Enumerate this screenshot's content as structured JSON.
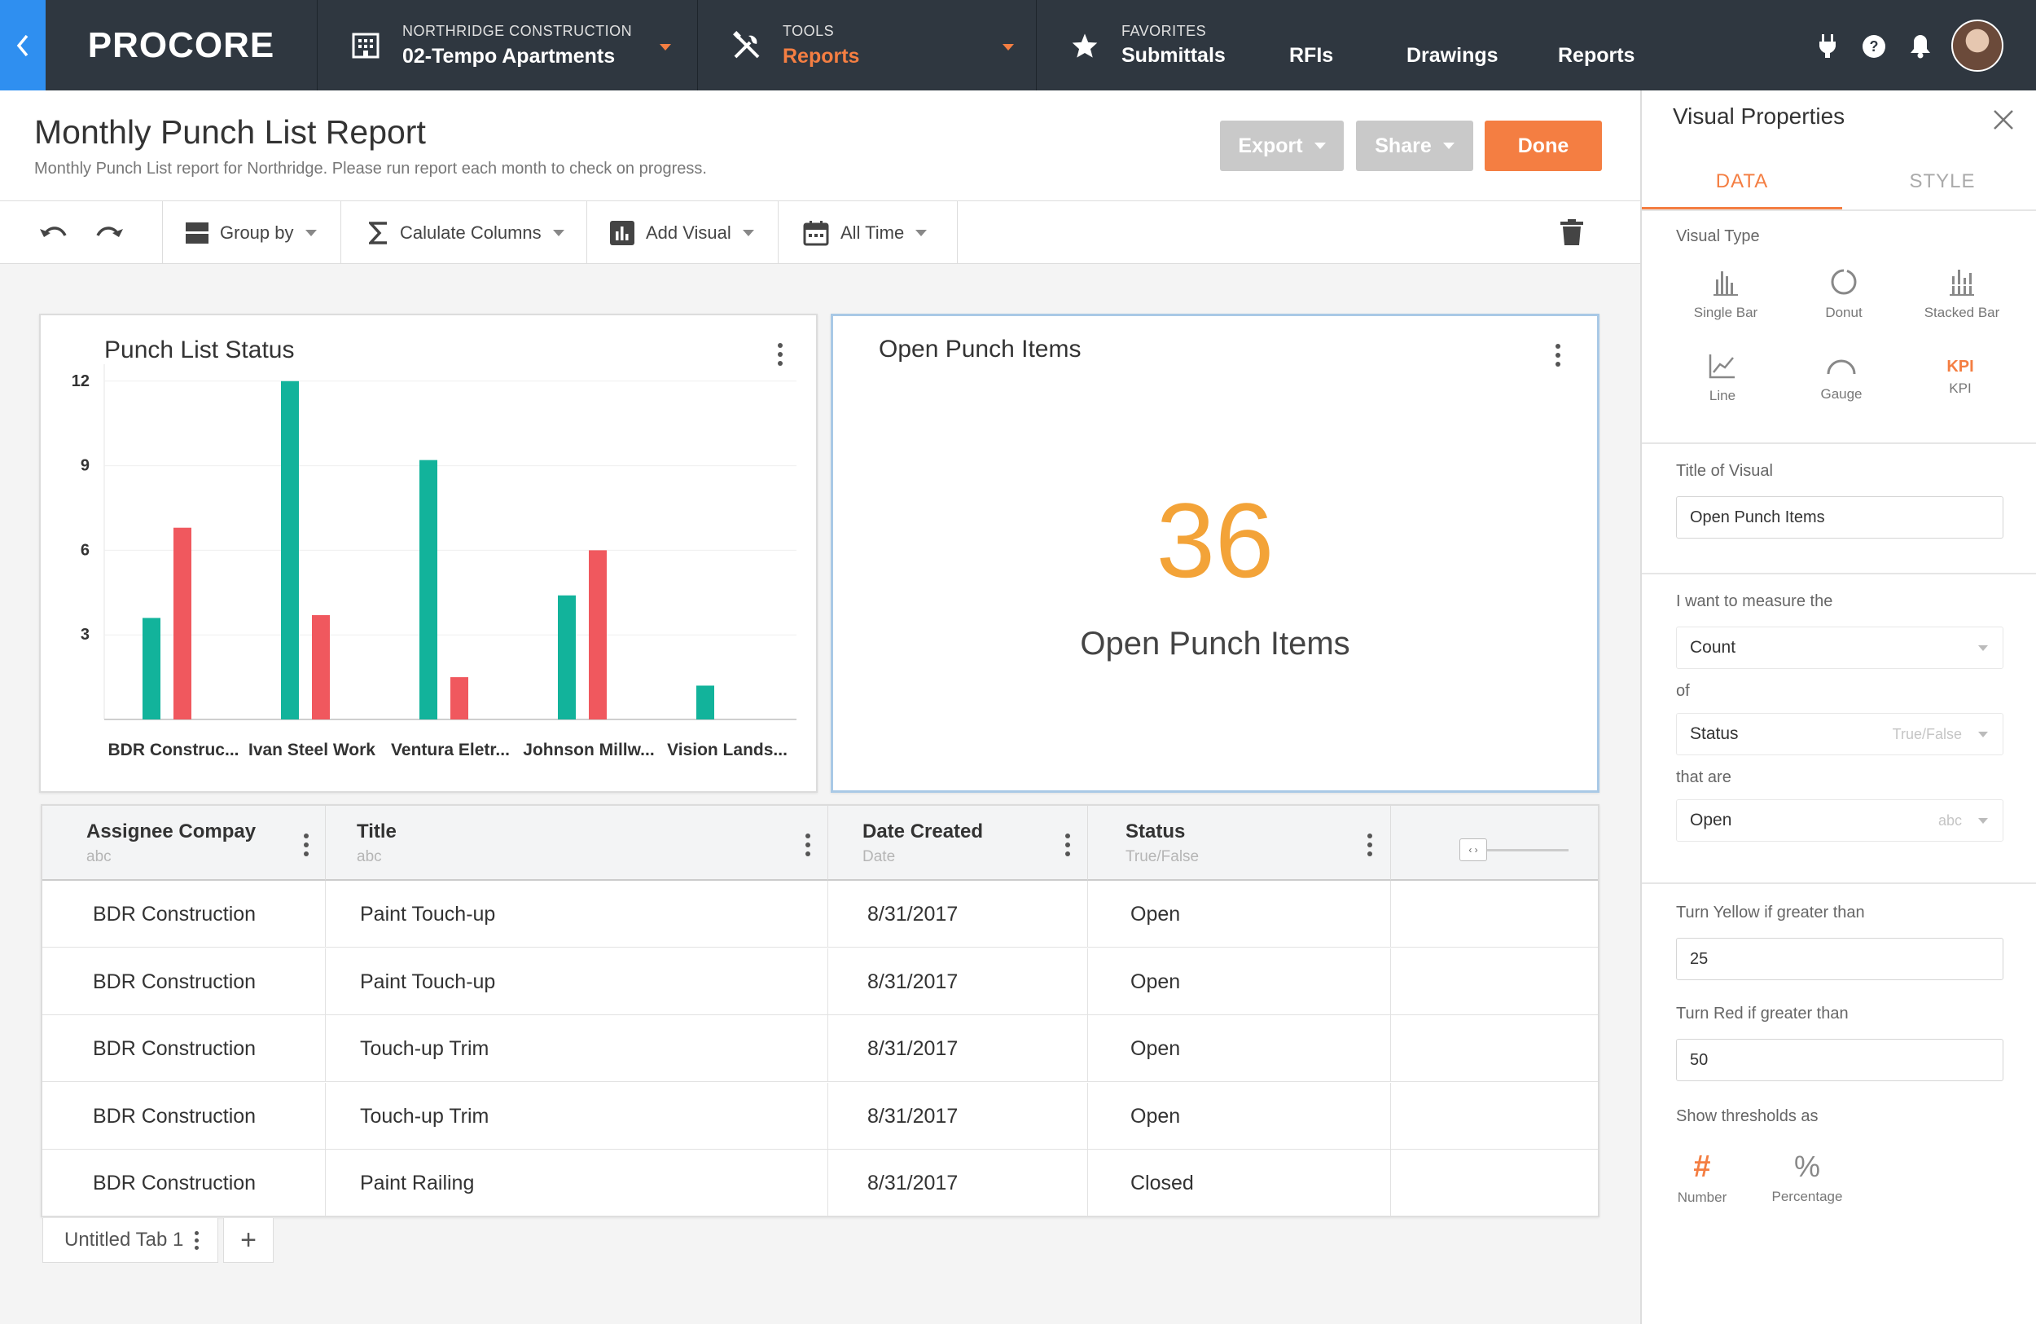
{
  "nav": {
    "logo": "PROCORE",
    "project_company": "NORTHRIDGE CONSTRUCTION",
    "project_name": "02-Tempo Apartments",
    "tools_label": "TOOLS",
    "tools_current": "Reports",
    "favorites_label": "FAVORITES",
    "favorites": [
      "Submittals",
      "RFIs",
      "Drawings",
      "Reports"
    ],
    "accent": "#f47e42",
    "back_color": "#2f8ff0"
  },
  "header": {
    "title": "Monthly Punch List Report",
    "subtitle": "Monthly Punch List report for Northridge. Please run report each month to check  on progress.",
    "export_label": "Export",
    "share_label": "Share",
    "done_label": "Done"
  },
  "toolbar": {
    "group_by": "Group by",
    "calculate_columns": "Calulate Columns",
    "add_visual": "Add Visual",
    "time_range": "All Time"
  },
  "chart_card": {
    "title": "Punch List Status"
  },
  "chart_data": {
    "type": "bar",
    "categories": [
      "BDR Construc...",
      "Ivan Steel Work",
      "Ventura Eletr...",
      "Johnson Millw...",
      "Vision Lands..."
    ],
    "series": [
      {
        "values": [
          3.6,
          12,
          9.2,
          4.4,
          1.2
        ],
        "color": "#12b39b"
      },
      {
        "values": [
          6.8,
          3.7,
          1.5,
          6,
          0
        ],
        "color": "#f0585e"
      }
    ],
    "yticks": [
      3,
      6,
      9,
      12
    ],
    "ylim": [
      0,
      12.6
    ],
    "grid": true
  },
  "kpi_card": {
    "title": "Open Punch Items",
    "value": "36",
    "label": "Open Punch Items",
    "value_color": "#f3a338"
  },
  "table": {
    "columns": [
      {
        "header": "Assignee Compay",
        "type": "abc"
      },
      {
        "header": "Title",
        "type": "abc"
      },
      {
        "header": "Date Created",
        "type": "Date"
      },
      {
        "header": "Status",
        "type": "True/False"
      }
    ],
    "rows": [
      [
        "BDR Construction",
        "Paint Touch-up",
        "8/31/2017",
        "Open"
      ],
      [
        "BDR Construction",
        "Paint Touch-up",
        "8/31/2017",
        "Open"
      ],
      [
        "BDR Construction",
        "Touch-up Trim",
        "8/31/2017",
        "Open"
      ],
      [
        "BDR Construction",
        "Touch-up Trim",
        "8/31/2017",
        "Open"
      ],
      [
        "BDR Construction",
        "Paint Railing",
        "8/31/2017",
        "Closed"
      ]
    ]
  },
  "tabs": {
    "items": [
      "Untitled Tab 1"
    ],
    "add": "+"
  },
  "panel": {
    "title": "Visual Properties",
    "tab_data": "DATA",
    "tab_style": "STYLE",
    "visual_type_label": "Visual Type",
    "visual_types": [
      "Single Bar",
      "Donut",
      "Stacked Bar",
      "Line",
      "Gauge",
      "KPI"
    ],
    "kpi_icon_text": "KPI",
    "title_label": "Title of Visual",
    "title_value": "Open Punch Items",
    "measure_label": "I want to measure the",
    "measure_value": "Count",
    "of_label": "of",
    "of_value": "Status",
    "of_hint": "True/False",
    "that_are_label": "that are",
    "that_are_value": "Open",
    "that_are_hint": "abc",
    "yellow_label": "Turn Yellow if greater than",
    "yellow_value": "25",
    "red_label": "Turn Red if greater than",
    "red_value": "50",
    "thresholds_label": "Show thresholds as",
    "number_symbol": "#",
    "number_label": "Number",
    "percent_symbol": "%",
    "percent_label": "Percentage"
  }
}
